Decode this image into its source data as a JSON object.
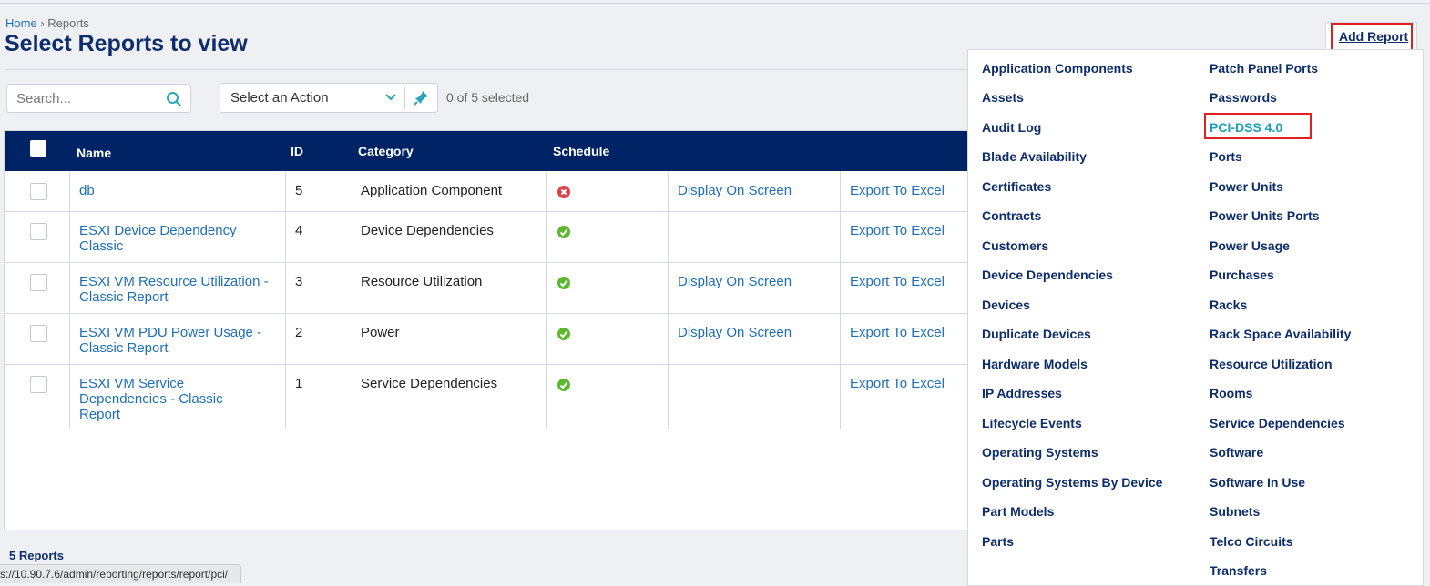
{
  "breadcrumb": {
    "home": "Home",
    "sep": "›",
    "current": "Reports"
  },
  "page_title": "Select Reports to view",
  "search": {
    "placeholder": "Search..."
  },
  "action_select": {
    "label": "Select an Action"
  },
  "selection_count": "0 of 5 selected",
  "table": {
    "columns": [
      "Name",
      "ID",
      "Category",
      "Schedule"
    ],
    "rows": [
      {
        "name": "db",
        "id": "5",
        "category": "Application Component",
        "schedule_status": "error",
        "display": "Display On Screen",
        "export": "Export To Excel"
      },
      {
        "name": "ESXI Device Dependency Classic",
        "id": "4",
        "category": "Device Dependencies",
        "schedule_status": "ok",
        "display": "",
        "export": "Export To Excel"
      },
      {
        "name": "ESXI VM Resource Utilization - Classic Report",
        "id": "3",
        "category": "Resource Utilization",
        "schedule_status": "ok",
        "display": "Display On Screen",
        "export": "Export To Excel"
      },
      {
        "name": "ESXI VM PDU Power Usage - Classic Report",
        "id": "2",
        "category": "Power",
        "schedule_status": "ok",
        "display": "Display On Screen",
        "export": "Export To Excel"
      },
      {
        "name": "ESXI VM Service Dependencies - Classic Report",
        "id": "1",
        "category": "Service Dependencies",
        "schedule_status": "ok",
        "display": "",
        "export": "Export To Excel"
      }
    ]
  },
  "footer_count": "5 Reports",
  "status_url": "s://10.90.7.6/admin/reporting/reports/report/pci/",
  "add_report": {
    "label": "Add Report"
  },
  "dropdown": {
    "left": [
      "Application Components",
      "Assets",
      "Audit Log",
      "Blade Availability",
      "Certificates",
      "Contracts",
      "Customers",
      "Device Dependencies",
      "Devices",
      "Duplicate Devices",
      "Hardware Models",
      "IP Addresses",
      "Lifecycle Events",
      "Operating Systems",
      "Operating Systems By Device",
      "Part Models",
      "Parts"
    ],
    "right": [
      "Patch Panel Ports",
      "Passwords",
      "PCI-DSS 4.0",
      "Ports",
      "Power Units",
      "Power Units Ports",
      "Power Usage",
      "Purchases",
      "Racks",
      "Rack Space Availability",
      "Resource Utilization",
      "Rooms",
      "Service Dependencies",
      "Software",
      "Software In Use",
      "Subnets",
      "Telco Circuits",
      "Transfers"
    ],
    "highlighted": "PCI-DSS 4.0"
  },
  "colors": {
    "header_bg": "#002366",
    "link": "#1f6fb8",
    "dropdown_text": "#0d2d6b",
    "active_item": "#1aa0b8",
    "ok": "#5cb82e",
    "error": "#e0404a",
    "highlight_box": "#e02020"
  }
}
